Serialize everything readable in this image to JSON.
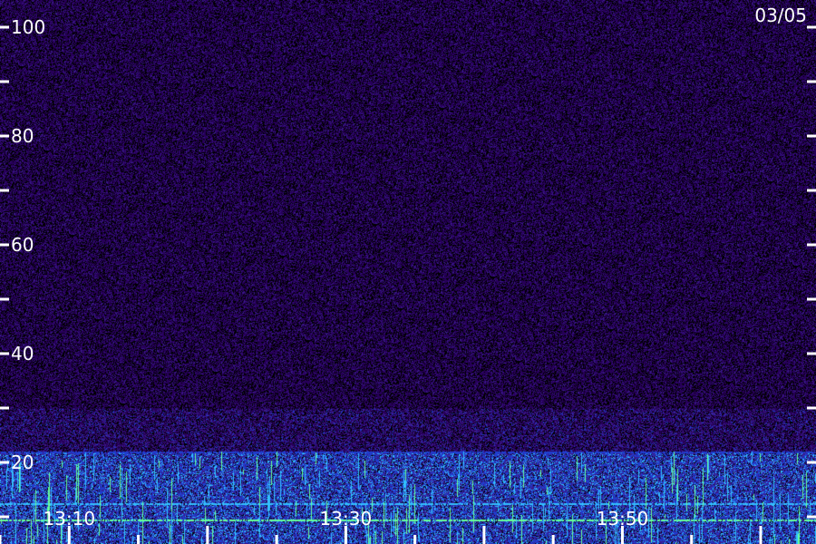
{
  "chart_data": {
    "type": "heatmap",
    "title": "",
    "xlabel": "",
    "ylabel": "",
    "date_label": "03/05",
    "y_axis": {
      "ylim": [
        5,
        105
      ],
      "labeled_ticks": [
        {
          "value": 100,
          "label": "100"
        },
        {
          "value": 80,
          "label": "80"
        },
        {
          "value": 60,
          "label": "60"
        },
        {
          "value": 40,
          "label": "40"
        },
        {
          "value": 20,
          "label": "20"
        }
      ],
      "minor_ticks": [
        90,
        70,
        50,
        30,
        10
      ]
    },
    "x_axis": {
      "range": [
        "13:05",
        "14:04"
      ],
      "labeled_ticks": [
        {
          "time": "13:10",
          "label": "13:10"
        },
        {
          "time": "13:30",
          "label": "13:30"
        },
        {
          "time": "13:50",
          "label": "13:50"
        }
      ],
      "minor_ticks": [
        "13:20",
        "13:40",
        "14:00"
      ]
    },
    "colors": {
      "background": "#27005a",
      "noise": "#3a1a8c",
      "band": "#1f3fd0",
      "bright": "#33c0ff",
      "line": "#66ff99"
    },
    "intensity_bands": [
      {
        "from": 5,
        "to": 22,
        "level": "high"
      },
      {
        "from": 22,
        "to": 30,
        "level": "medium"
      },
      {
        "from": 30,
        "to": 105,
        "level": "low"
      }
    ],
    "persistent_lines": [
      {
        "value": 9.5,
        "color": "line"
      },
      {
        "value": 12.5,
        "color": "bright"
      },
      {
        "value": 22,
        "color": "band"
      }
    ]
  }
}
